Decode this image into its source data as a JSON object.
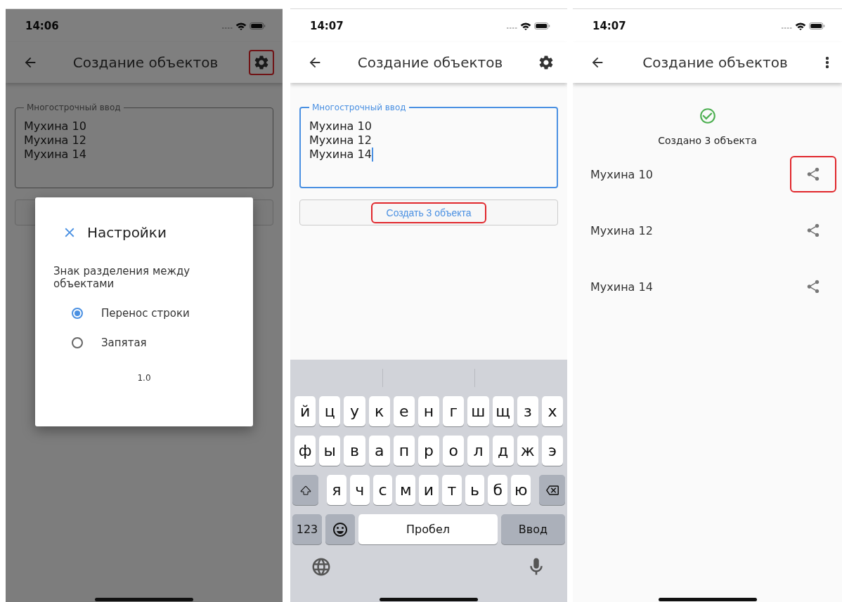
{
  "screens": [
    {
      "kind": "form_with_dialog",
      "dimmed": true,
      "status_bar": {
        "time": "14:06"
      },
      "app_bar": {
        "title": "Создание объектов",
        "kind": "settings",
        "action_highlighted": true
      },
      "field": {
        "label": "Многострочный ввод",
        "lines": [
          "Мухина 10",
          "Мухина 12",
          "Мухина 14"
        ],
        "focused": false
      },
      "dialog": {
        "title": "Настройки",
        "prompt": "Знак разделения между объектами",
        "options": [
          {
            "label": "Перенос строки",
            "selected": true
          },
          {
            "label": "Запятая",
            "selected": false
          }
        ],
        "version": "1.0"
      }
    },
    {
      "kind": "form_with_keyboard",
      "status_bar": {
        "time": "14:07"
      },
      "app_bar": {
        "title": "Создание объектов",
        "kind": "settings",
        "action_highlighted": false
      },
      "field": {
        "label": "Многострочный ввод",
        "lines": [
          "Мухина 10",
          "Мухина 12",
          "Мухина 14"
        ],
        "focused": true
      },
      "create_button": {
        "label": "Создать 3 объекта",
        "highlighted": true
      },
      "keyboard": {
        "rows": [
          {
            "keys": [
              "й",
              "ц",
              "у",
              "к",
              "е",
              "н",
              "г",
              "ш",
              "щ",
              "з",
              "х"
            ]
          },
          {
            "keys": [
              "ф",
              "ы",
              "в",
              "а",
              "п",
              "р",
              "о",
              "л",
              "д",
              "ж",
              "э"
            ]
          },
          {
            "keys": [
              "я",
              "ч",
              "с",
              "м",
              "и",
              "т",
              "ь",
              "б",
              "ю"
            ]
          }
        ],
        "numbers_key": "123",
        "space_key": "Пробел",
        "return_key": "Ввод"
      }
    },
    {
      "kind": "result",
      "status_bar": {
        "time": "14:07"
      },
      "app_bar": {
        "title": "Создание объектов",
        "kind": "more",
        "action_highlighted": false
      },
      "message": "Создано 3 объекта",
      "items": [
        {
          "label": "Мухина 10",
          "highlighted": true
        },
        {
          "label": "Мухина 12",
          "highlighted": false
        },
        {
          "label": "Мухина 14",
          "highlighted": false
        }
      ]
    }
  ]
}
